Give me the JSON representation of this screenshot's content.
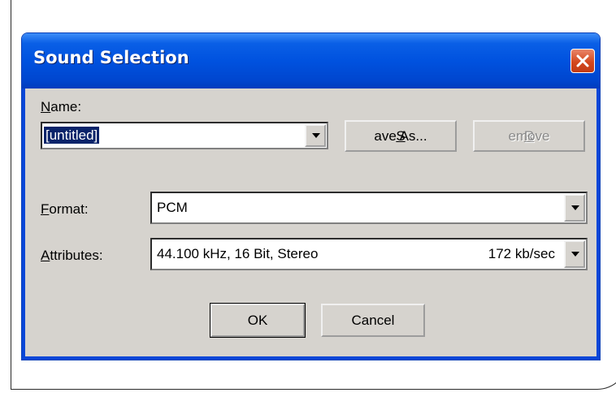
{
  "dialog": {
    "title": "Sound Selection"
  },
  "name": {
    "label_prefix": "",
    "label_mnemonic": "N",
    "label_rest": "ame:",
    "value": "[untitled]"
  },
  "buttons": {
    "save_as_mnemonic": "S",
    "save_as_rest": "ave As...",
    "remove_mnemonic": "R",
    "remove_rest": "emove",
    "ok": "OK",
    "cancel": "Cancel"
  },
  "format": {
    "label_mnemonic": "F",
    "label_rest": "ormat:",
    "value": "PCM"
  },
  "attributes": {
    "label_mnemonic": "A",
    "label_rest": "ttributes:",
    "value": "44.100 kHz, 16 Bit, Stereo",
    "rate": "172 kb/sec"
  },
  "colors": {
    "title_bar": "#0052df",
    "dialog_face": "#d6d3ce",
    "selection": "#0a246a",
    "close_button": "#d4481f"
  }
}
